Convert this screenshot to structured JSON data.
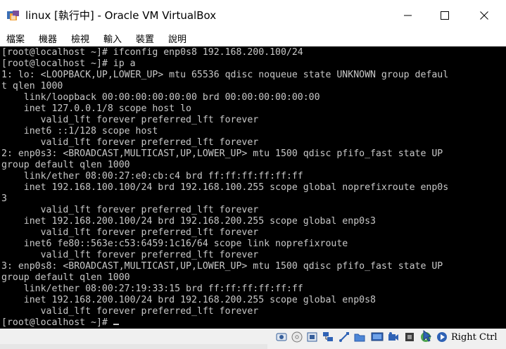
{
  "window": {
    "title": "linux [執行中] - Oracle VM VirtualBox"
  },
  "menu": {
    "items": [
      "檔案",
      "機器",
      "檢視",
      "輸入",
      "裝置",
      "說明"
    ]
  },
  "terminal": {
    "lines": [
      "[root@localhost ~]# ifconfig enp0s8 192.168.200.100/24",
      "[root@localhost ~]# ip a",
      "1: lo: <LOOPBACK,UP,LOWER_UP> mtu 65536 qdisc noqueue state UNKNOWN group defaul",
      "t qlen 1000",
      "    link/loopback 00:00:00:00:00:00 brd 00:00:00:00:00:00",
      "    inet 127.0.0.1/8 scope host lo",
      "       valid_lft forever preferred_lft forever",
      "    inet6 ::1/128 scope host",
      "       valid_lft forever preferred_lft forever",
      "2: enp0s3: <BROADCAST,MULTICAST,UP,LOWER_UP> mtu 1500 qdisc pfifo_fast state UP",
      "group default qlen 1000",
      "    link/ether 08:00:27:e0:cb:c4 brd ff:ff:ff:ff:ff:ff",
      "    inet 192.168.100.100/24 brd 192.168.100.255 scope global noprefixroute enp0s",
      "3",
      "       valid_lft forever preferred_lft forever",
      "    inet 192.168.200.100/24 brd 192.168.200.255 scope global enp0s3",
      "       valid_lft forever preferred_lft forever",
      "    inet6 fe80::563e:c53:6459:1c16/64 scope link noprefixroute",
      "       valid_lft forever preferred_lft forever",
      "3: enp0s8: <BROADCAST,MULTICAST,UP,LOWER_UP> mtu 1500 qdisc pfifo_fast state UP",
      "group default qlen 1000",
      "    link/ether 08:00:27:19:33:15 brd ff:ff:ff:ff:ff:ff",
      "    inet 192.168.200.100/24 brd 192.168.200.255 scope global enp0s8",
      "       valid_lft forever preferred_lft forever",
      "[root@localhost ~]# "
    ],
    "foreground": "#c8c8c8",
    "background": "#000000"
  },
  "statusbar": {
    "icons": [
      "hard-disk-icon",
      "optical-drive-icon",
      "audio-icon",
      "network-icon",
      "usb-icon",
      "shared-folders-icon",
      "display-icon",
      "video-capture-icon",
      "cpu-icon",
      "virtualization-icon",
      "mouse-integration-icon",
      "keyboard-icon"
    ],
    "host_key": "Right Ctrl"
  },
  "colors": {
    "title_bar": "#ffffff",
    "status_bar": "#f0f0f0",
    "icon_blue": "#1f5fbf"
  }
}
